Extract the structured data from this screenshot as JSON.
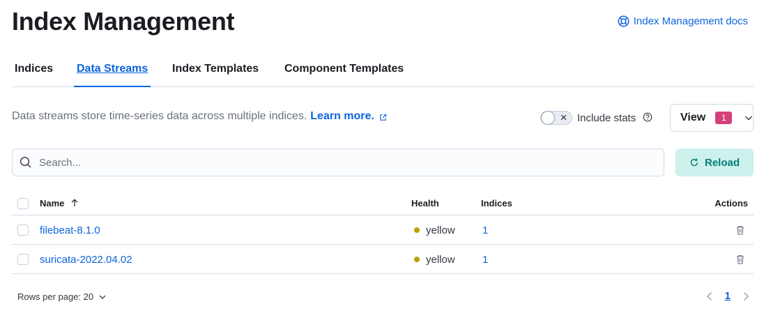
{
  "header": {
    "title": "Index Management",
    "docs_link": "Index Management docs"
  },
  "tabs": [
    {
      "label": "Indices",
      "active": false
    },
    {
      "label": "Data Streams",
      "active": true
    },
    {
      "label": "Index Templates",
      "active": false
    },
    {
      "label": "Component Templates",
      "active": false
    }
  ],
  "description": {
    "text": "Data streams store time-series data across multiple indices.",
    "learn_more": "Learn more."
  },
  "stats_toggle": {
    "label": "Include stats",
    "checked": false
  },
  "view_button": {
    "label": "View",
    "badge": "1"
  },
  "search": {
    "placeholder": "Search..."
  },
  "reload_button": {
    "label": "Reload"
  },
  "table": {
    "columns": {
      "name": "Name",
      "health": "Health",
      "indices": "Indices",
      "actions": "Actions"
    },
    "rows": [
      {
        "name": "filebeat-8.1.0",
        "health": "yellow",
        "indices": "1"
      },
      {
        "name": "suricata-2022.04.02",
        "health": "yellow",
        "indices": "1"
      }
    ]
  },
  "pagination": {
    "rows_per_page": "Rows per page: 20",
    "current_page": "1"
  },
  "colors": {
    "primary": "#0b64dd",
    "health_yellow": "#b9a000",
    "badge": "#d6407a",
    "reload_bg": "#cdf1ec",
    "reload_text": "#017d73"
  },
  "icons": {
    "docs": "lifebuoy-icon",
    "external": "external-link-icon",
    "help": "help-icon",
    "search": "search-icon",
    "reload": "refresh-icon",
    "sort": "sort-up-icon",
    "delete": "trash-icon",
    "chevron": "chevron-down-icon"
  }
}
